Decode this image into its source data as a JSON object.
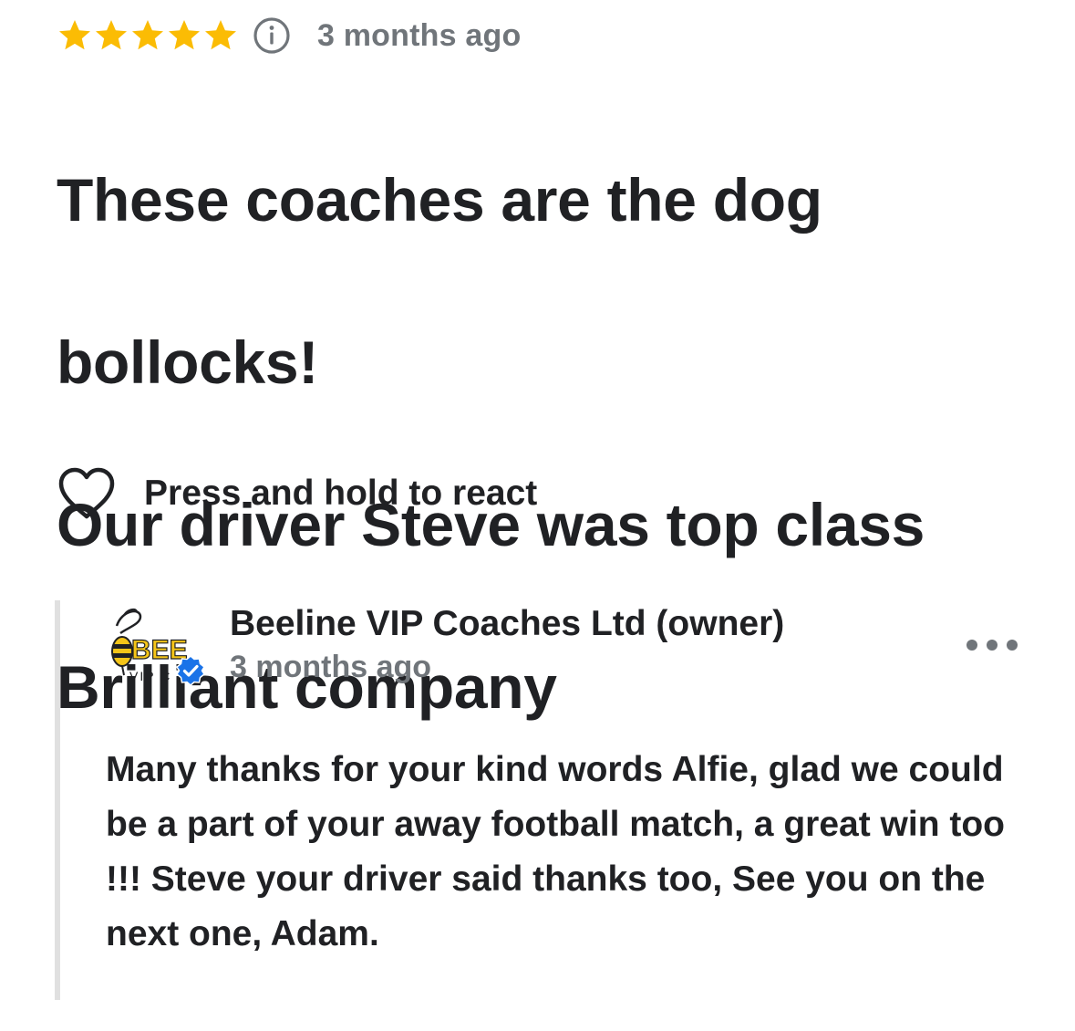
{
  "review": {
    "rating": 5,
    "rating_max": 5,
    "star_color": "#fbbc04",
    "date": "3 months ago",
    "lines": [
      "These coaches are the dog",
      "bollocks!",
      "Our driver Steve was top class",
      "Brilliant company"
    ]
  },
  "reaction": {
    "label": "Press and hold to react",
    "icon": "heart-outline-icon"
  },
  "owner_reply": {
    "name": "Beeline VIP Coaches Ltd (owner)",
    "date": "3 months ago",
    "logo_text": "BEE",
    "logo_subtext": "VIP C",
    "verified_color": "#1a73e8",
    "text": "Many thanks for your kind words Alfie, glad we could be a part of your away football match, a great win too !!! Steve your driver said thanks too, See you on the next one, Adam."
  },
  "colors": {
    "text_primary": "#202124",
    "text_secondary": "#70757a",
    "divider": "#e0e0e0",
    "logo_yellow": "#f5c518"
  }
}
